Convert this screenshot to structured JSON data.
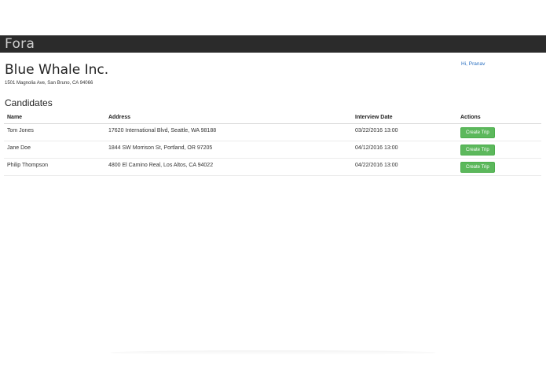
{
  "app": {
    "brand": "Fora"
  },
  "company": {
    "name": "Blue Whale Inc.",
    "address": "1501 Magnolia Ave, San Bruno, CA 94066"
  },
  "user": {
    "greeting": "Hi, Pranav"
  },
  "candidates": {
    "title": "Candidates",
    "columns": [
      "Name",
      "Address",
      "Interview Date",
      "Actions"
    ],
    "rows": [
      {
        "name": "Tom Jones",
        "address": "17620 International Blvd, Seattle, WA 98188",
        "interview_date": "03/22/2016 13:00",
        "action_label": "Create Trip"
      },
      {
        "name": "Jane Doe",
        "address": "1844 SW Morrison St, Portland, OR 97205",
        "interview_date": "04/12/2016 13:00",
        "action_label": "Create Trip"
      },
      {
        "name": "Philip Thompson",
        "address": "4800 El Camino Real, Los Altos, CA 94022",
        "interview_date": "04/22/2016 13:00",
        "action_label": "Create Trip"
      }
    ]
  },
  "colors": {
    "navbar_bg": "#2b2b2b",
    "brand_text": "#cfcfcf",
    "link": "#2a6fc0",
    "button_success": "#5cb85c"
  }
}
